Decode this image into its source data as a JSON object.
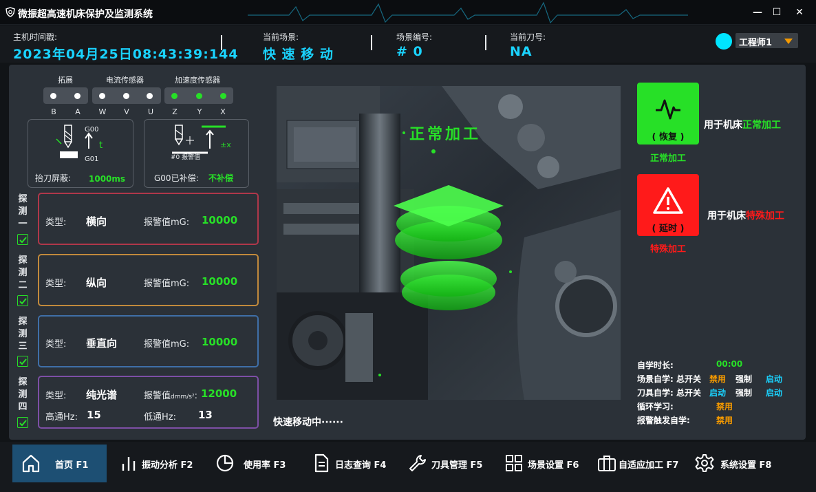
{
  "app": {
    "title": "微振超高速机床保护及监测系统"
  },
  "window": {
    "minimize": "—",
    "maximize": "☐",
    "close": "✕"
  },
  "header": {
    "time_label": "主机时间戳:",
    "time_value": "2023年04月25日08:43:39:144",
    "scene_label": "当前场景:",
    "scene_value": "快 速 移 动",
    "scene_no_label": "场景编号:",
    "scene_no_value": "# 0",
    "tool_label": "当前刀号:",
    "tool_value": "NA",
    "user": "工程师1"
  },
  "sensors": {
    "groups": [
      "拓展",
      "电流传感器",
      "加速度传感器"
    ],
    "axes": [
      "B",
      "A",
      "W",
      "V",
      "U",
      "Z",
      "Y",
      "X"
    ],
    "states": [
      "off",
      "off",
      "off",
      "off",
      "off",
      "on",
      "on",
      "on"
    ],
    "on_color": "#27e027"
  },
  "lift": {
    "g00": "G00",
    "g01": "G01",
    "t": "t",
    "label": "抬刀屏蔽:",
    "value": "1000ms"
  },
  "comp": {
    "tool": "#0 报警值",
    "pm": "±x",
    "label": "G00已补偿:",
    "value": "不补偿"
  },
  "probes": [
    {
      "side": [
        "探",
        "测",
        "一"
      ],
      "type_label": "类型:",
      "type": "横向",
      "alarm_label": "报警值mG:",
      "alarm": "10000",
      "color": "#b0374a"
    },
    {
      "side": [
        "探",
        "测",
        "二"
      ],
      "type_label": "类型:",
      "type": "纵向",
      "alarm_label": "报警值mG:",
      "alarm": "10000",
      "color": "#c28a3c"
    },
    {
      "side": [
        "探",
        "测",
        "三"
      ],
      "type_label": "类型:",
      "type": "垂直向",
      "alarm_label": "报警值mG:",
      "alarm": "10000",
      "color": "#3f6fa8"
    },
    {
      "side": [
        "探",
        "测",
        "四"
      ],
      "type_label": "类型:",
      "type": "纯光谱",
      "alarm_label": "报警值",
      "alarm_unit": "dmm/s²",
      "alarm_colon": ":",
      "alarm": "12000",
      "hp_label": "高通Hz:",
      "hp": "15",
      "lp_label": "低通Hz:",
      "lp": "13",
      "color": "#7d4fa6"
    }
  ],
  "center": {
    "overlay": "正常加工",
    "status": "快速移动中······"
  },
  "modes": {
    "normal": {
      "sub": "( 恢复 )",
      "caption": "正常加工",
      "desc_prefix": "用于机床",
      "desc_hl": "正常加工",
      "color": "#27e027"
    },
    "special": {
      "sub": "( 延时 )",
      "caption": "特殊加工",
      "desc_prefix": "用于机床",
      "desc_hl": "特殊加工",
      "color": "#ff1a1a"
    }
  },
  "learning": {
    "duration_label": "自学时长:",
    "duration": "00:00",
    "scene_label": "场景自学: 总开关",
    "scene_switch": "禁用",
    "scene_force": "强制",
    "scene_state": "启动",
    "tool_label": "刀具自学: 总开关",
    "tool_switch": "启动",
    "tool_force": "强制",
    "tool_state": "启动",
    "loop_label": "循环学习:",
    "loop": "禁用",
    "alarm_label": "报警触发自学:",
    "alarm": "禁用"
  },
  "nav": [
    {
      "label": "首页  F1",
      "icon": "home-icon"
    },
    {
      "label": "振动分析  F2",
      "icon": "bar-chart-icon"
    },
    {
      "label": "使用率  F3",
      "icon": "pie-chart-icon"
    },
    {
      "label": "日志查询  F4",
      "icon": "document-icon"
    },
    {
      "label": "刀具管理  F5",
      "icon": "wrench-icon"
    },
    {
      "label": "场景设置  F6",
      "icon": "grid-icon"
    },
    {
      "label": "自适应加工  F7",
      "icon": "briefcase-icon"
    },
    {
      "label": "系统设置  F8",
      "icon": "gear-icon"
    }
  ]
}
